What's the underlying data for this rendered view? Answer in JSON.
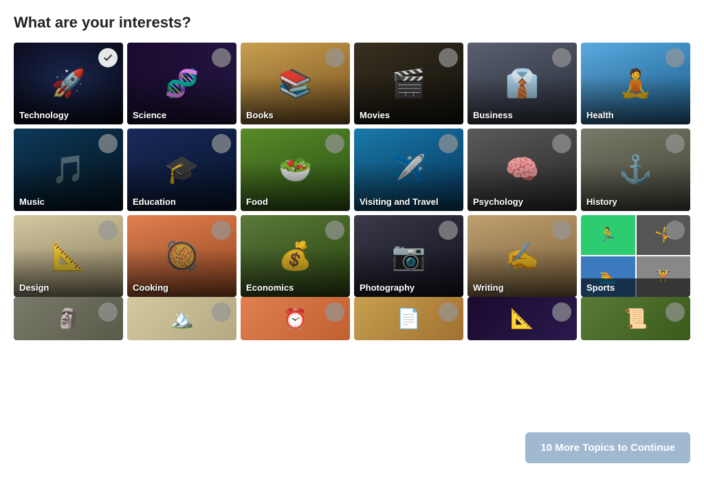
{
  "page": {
    "title": "What are your interests?"
  },
  "tiles": [
    {
      "id": "technology",
      "label": "Technology",
      "selected": true,
      "bgClass": "bg-technology",
      "emoji": "🚀"
    },
    {
      "id": "science",
      "label": "Science",
      "selected": false,
      "bgClass": "bg-science",
      "emoji": "🧬"
    },
    {
      "id": "books",
      "label": "Books",
      "selected": false,
      "bgClass": "bg-books",
      "emoji": "📚"
    },
    {
      "id": "movies",
      "label": "Movies",
      "selected": false,
      "bgClass": "bg-movies",
      "emoji": "🎬"
    },
    {
      "id": "business",
      "label": "Business",
      "selected": false,
      "bgClass": "bg-business",
      "emoji": "👔"
    },
    {
      "id": "health",
      "label": "Health",
      "selected": false,
      "bgClass": "bg-health",
      "emoji": "🧘"
    },
    {
      "id": "music",
      "label": "Music",
      "selected": false,
      "bgClass": "bg-music",
      "emoji": "🎵"
    },
    {
      "id": "education",
      "label": "Education",
      "selected": false,
      "bgClass": "bg-education",
      "emoji": "🎓"
    },
    {
      "id": "food",
      "label": "Food",
      "selected": false,
      "bgClass": "bg-food",
      "emoji": "🥗"
    },
    {
      "id": "visiting",
      "label": "Visiting and Travel",
      "selected": false,
      "bgClass": "bg-visiting",
      "emoji": "✈️"
    },
    {
      "id": "psychology",
      "label": "Psychology",
      "selected": false,
      "bgClass": "bg-psychology",
      "emoji": "🧠"
    },
    {
      "id": "history",
      "label": "History",
      "selected": false,
      "bgClass": "bg-history",
      "emoji": "⚓"
    },
    {
      "id": "design",
      "label": "Design",
      "selected": false,
      "bgClass": "bg-design",
      "emoji": "📐"
    },
    {
      "id": "cooking",
      "label": "Cooking",
      "selected": false,
      "bgClass": "bg-cooking",
      "emoji": "🥘"
    },
    {
      "id": "economics",
      "label": "Economics",
      "selected": false,
      "bgClass": "bg-economics",
      "emoji": "💰"
    },
    {
      "id": "photography",
      "label": "Photography",
      "selected": false,
      "bgClass": "bg-photography",
      "emoji": "📷"
    },
    {
      "id": "writing",
      "label": "Writing",
      "selected": false,
      "bgClass": "bg-writing",
      "emoji": "✍️"
    }
  ],
  "sports": {
    "label": "Sports",
    "selected": false
  },
  "bottom_tiles": [
    {
      "id": "bottom1",
      "bgClass": "bg-history",
      "emoji": "🗿"
    },
    {
      "id": "bottom2",
      "bgClass": "bg-design",
      "emoji": "🏔️"
    },
    {
      "id": "bottom3",
      "bgClass": "bg-cooking",
      "emoji": "⏰"
    },
    {
      "id": "bottom4",
      "bgClass": "bg-books",
      "emoji": "📄"
    },
    {
      "id": "bottom5",
      "bgClass": "bg-science",
      "emoji": "📐"
    },
    {
      "id": "bottom6",
      "bgClass": "bg-economics",
      "emoji": "📜"
    }
  ],
  "continue_button": {
    "label": "10 More Topics to Continue"
  }
}
